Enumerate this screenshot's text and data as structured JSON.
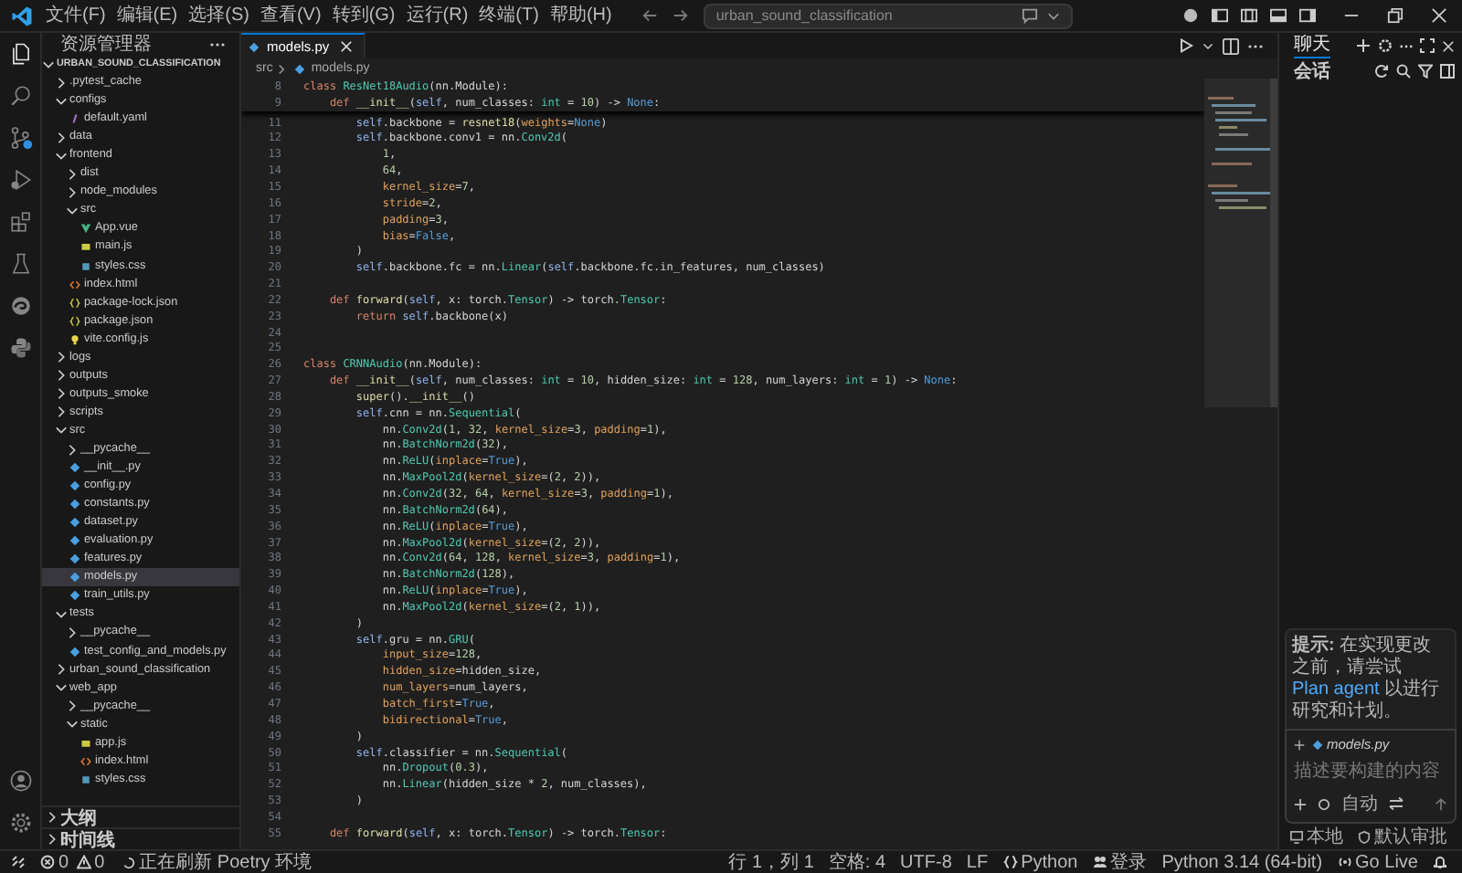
{
  "menu": [
    "文件(F)",
    "编辑(E)",
    "选择(S)",
    "查看(V)",
    "转到(G)",
    "运行(R)",
    "终端(T)",
    "帮助(H)"
  ],
  "command_center": {
    "value": "urban_sound_classification"
  },
  "explorer": {
    "title": "资源管理器",
    "root": {
      "name": "URBAN_SOUND_CLASSIFICATION",
      "expanded": true
    },
    "tree": [
      {
        "name": ".pytest_cache",
        "kind": "folder",
        "expanded": false,
        "selected": false
      },
      {
        "name": "configs",
        "kind": "folder",
        "expanded": true,
        "selected": false,
        "children": [
          {
            "name": "default.yaml",
            "kind": "yaml",
            "selected": false
          }
        ]
      },
      {
        "name": "data",
        "kind": "folder",
        "expanded": false,
        "selected": false
      },
      {
        "name": "frontend",
        "kind": "folder",
        "expanded": true,
        "selected": false,
        "children": [
          {
            "name": "dist",
            "kind": "folder",
            "expanded": false,
            "selected": false
          },
          {
            "name": "node_modules",
            "kind": "folder",
            "expanded": false,
            "selected": false
          },
          {
            "name": "src",
            "kind": "folder",
            "expanded": true,
            "selected": false,
            "children": [
              {
                "name": "App.vue",
                "kind": "vue",
                "selected": false
              },
              {
                "name": "main.js",
                "kind": "js",
                "selected": false
              },
              {
                "name": "styles.css",
                "kind": "css",
                "selected": false
              }
            ]
          },
          {
            "name": "index.html",
            "kind": "html",
            "selected": false
          },
          {
            "name": "package-lock.json",
            "kind": "json",
            "selected": false
          },
          {
            "name": "package.json",
            "kind": "json",
            "selected": false
          },
          {
            "name": "vite.config.js",
            "kind": "config",
            "selected": false
          }
        ]
      },
      {
        "name": "logs",
        "kind": "folder",
        "expanded": false,
        "selected": false
      },
      {
        "name": "outputs",
        "kind": "folder",
        "expanded": false,
        "selected": false
      },
      {
        "name": "outputs_smoke",
        "kind": "folder",
        "expanded": false,
        "selected": false
      },
      {
        "name": "scripts",
        "kind": "folder",
        "expanded": false,
        "selected": false
      },
      {
        "name": "src",
        "kind": "folder",
        "expanded": true,
        "selected": false,
        "children": [
          {
            "name": "__pycache__",
            "kind": "folder",
            "expanded": false,
            "selected": false
          },
          {
            "name": "__init__.py",
            "kind": "py",
            "selected": false
          },
          {
            "name": "config.py",
            "kind": "py",
            "selected": false
          },
          {
            "name": "constants.py",
            "kind": "py",
            "selected": false
          },
          {
            "name": "dataset.py",
            "kind": "py",
            "selected": false
          },
          {
            "name": "evaluation.py",
            "kind": "py",
            "selected": false
          },
          {
            "name": "features.py",
            "kind": "py",
            "selected": false
          },
          {
            "name": "models.py",
            "kind": "py",
            "selected": true
          },
          {
            "name": "train_utils.py",
            "kind": "py",
            "selected": false
          }
        ]
      },
      {
        "name": "tests",
        "kind": "folder",
        "expanded": true,
        "selected": false,
        "children": [
          {
            "name": "__pycache__",
            "kind": "folder",
            "expanded": false,
            "selected": false
          },
          {
            "name": "test_config_and_models.py",
            "kind": "py",
            "selected": false
          }
        ]
      },
      {
        "name": "urban_sound_classification",
        "kind": "folder",
        "expanded": false,
        "selected": false
      },
      {
        "name": "web_app",
        "kind": "folder",
        "expanded": true,
        "selected": false,
        "children": [
          {
            "name": "__pycache__",
            "kind": "folder",
            "expanded": false,
            "selected": false
          },
          {
            "name": "static",
            "kind": "folder",
            "expanded": true,
            "selected": false,
            "children": [
              {
                "name": "app.js",
                "kind": "js",
                "selected": false
              },
              {
                "name": "index.html",
                "kind": "html",
                "selected": false
              },
              {
                "name": "styles.css",
                "kind": "css",
                "selected": false
              }
            ]
          }
        ]
      }
    ],
    "sections": [
      {
        "name": "大纲",
        "expanded": false
      },
      {
        "name": "时间线",
        "expanded": false
      }
    ]
  },
  "editor": {
    "tab": {
      "name": "models.py",
      "selected": true
    },
    "breadcrumb": [
      "src",
      "models.py"
    ],
    "sticky_lines": [
      {
        "no": "8",
        "segs": [
          {
            "kind": "keyword",
            "text": "class "
          },
          {
            "kind": "type",
            "text": "ResNet18Audio"
          },
          {
            "kind": "plain",
            "text": "(nn.Module):"
          }
        ]
      },
      {
        "no": "9",
        "segs": [
          {
            "kind": "keyword",
            "text": "    def "
          },
          {
            "kind": "function",
            "text": "__init__"
          },
          {
            "kind": "plain",
            "text": "("
          },
          {
            "kind": "self",
            "text": "self"
          },
          {
            "kind": "plain",
            "text": ", num_classes: "
          },
          {
            "kind": "type",
            "text": "int"
          },
          {
            "kind": "plain",
            "text": " = "
          },
          {
            "kind": "number",
            "text": "10"
          },
          {
            "kind": "plain",
            "text": ") -> "
          },
          {
            "kind": "constant",
            "text": "None"
          },
          {
            "kind": "plain",
            "text": ":"
          }
        ]
      }
    ],
    "lines": [
      {
        "no": "11",
        "segs": [
          {
            "kind": "self",
            "text": "        self"
          },
          {
            "kind": "plain",
            "text": ".backbone = "
          },
          {
            "kind": "function",
            "text": "resnet18"
          },
          {
            "kind": "plain",
            "text": "("
          },
          {
            "kind": "param",
            "text": "weights"
          },
          {
            "kind": "plain",
            "text": "="
          },
          {
            "kind": "constant",
            "text": "None"
          },
          {
            "kind": "plain",
            "text": ")"
          }
        ]
      },
      {
        "no": "12",
        "segs": [
          {
            "kind": "self",
            "text": "        self"
          },
          {
            "kind": "plain",
            "text": ".backbone.conv1 = nn."
          },
          {
            "kind": "type",
            "text": "Conv2d"
          },
          {
            "kind": "plain",
            "text": "("
          }
        ]
      },
      {
        "no": "13",
        "segs": [
          {
            "kind": "number",
            "text": "            1"
          },
          {
            "kind": "plain",
            "text": ","
          }
        ]
      },
      {
        "no": "14",
        "segs": [
          {
            "kind": "number",
            "text": "            64"
          },
          {
            "kind": "plain",
            "text": ","
          }
        ]
      },
      {
        "no": "15",
        "segs": [
          {
            "kind": "param",
            "text": "            kernel_size"
          },
          {
            "kind": "plain",
            "text": "="
          },
          {
            "kind": "number",
            "text": "7"
          },
          {
            "kind": "plain",
            "text": ","
          }
        ]
      },
      {
        "no": "16",
        "segs": [
          {
            "kind": "param",
            "text": "            stride"
          },
          {
            "kind": "plain",
            "text": "="
          },
          {
            "kind": "number",
            "text": "2"
          },
          {
            "kind": "plain",
            "text": ","
          }
        ]
      },
      {
        "no": "17",
        "segs": [
          {
            "kind": "param",
            "text": "            padding"
          },
          {
            "kind": "plain",
            "text": "="
          },
          {
            "kind": "number",
            "text": "3"
          },
          {
            "kind": "plain",
            "text": ","
          }
        ]
      },
      {
        "no": "18",
        "segs": [
          {
            "kind": "param",
            "text": "            bias"
          },
          {
            "kind": "plain",
            "text": "="
          },
          {
            "kind": "constant",
            "text": "False"
          },
          {
            "kind": "plain",
            "text": ","
          }
        ]
      },
      {
        "no": "19",
        "segs": [
          {
            "kind": "plain",
            "text": "        )"
          }
        ]
      },
      {
        "no": "20",
        "segs": [
          {
            "kind": "self",
            "text": "        self"
          },
          {
            "kind": "plain",
            "text": ".backbone.fc = nn."
          },
          {
            "kind": "type",
            "text": "Linear"
          },
          {
            "kind": "plain",
            "text": "("
          },
          {
            "kind": "self",
            "text": "self"
          },
          {
            "kind": "plain",
            "text": ".backbone.fc.in_features, num_classes)"
          }
        ]
      },
      {
        "no": "21"
      },
      {
        "no": "22",
        "segs": [
          {
            "kind": "keyword",
            "text": "    def "
          },
          {
            "kind": "function",
            "text": "forward"
          },
          {
            "kind": "plain",
            "text": "("
          },
          {
            "kind": "self",
            "text": "self"
          },
          {
            "kind": "plain",
            "text": ", x: torch."
          },
          {
            "kind": "type",
            "text": "Tensor"
          },
          {
            "kind": "plain",
            "text": ") -> torch."
          },
          {
            "kind": "type",
            "text": "Tensor"
          },
          {
            "kind": "plain",
            "text": ":"
          }
        ]
      },
      {
        "no": "23",
        "segs": [
          {
            "kind": "keyword",
            "text": "        return "
          },
          {
            "kind": "self",
            "text": "self"
          },
          {
            "kind": "plain",
            "text": ".backbone(x)"
          }
        ]
      },
      {
        "no": "24"
      },
      {
        "no": "25"
      },
      {
        "no": "26",
        "segs": [
          {
            "kind": "keyword",
            "text": "class "
          },
          {
            "kind": "type",
            "text": "CRNNAudio"
          },
          {
            "kind": "plain",
            "text": "(nn.Module):"
          }
        ]
      },
      {
        "no": "27",
        "segs": [
          {
            "kind": "keyword",
            "text": "    def "
          },
          {
            "kind": "function",
            "text": "__init__"
          },
          {
            "kind": "plain",
            "text": "("
          },
          {
            "kind": "self",
            "text": "self"
          },
          {
            "kind": "plain",
            "text": ", num_classes: "
          },
          {
            "kind": "type",
            "text": "int"
          },
          {
            "kind": "plain",
            "text": " = "
          },
          {
            "kind": "number",
            "text": "10"
          },
          {
            "kind": "plain",
            "text": ", hidden_size: "
          },
          {
            "kind": "type",
            "text": "int"
          },
          {
            "kind": "plain",
            "text": " = "
          },
          {
            "kind": "number",
            "text": "128"
          },
          {
            "kind": "plain",
            "text": ", num_layers: "
          },
          {
            "kind": "type",
            "text": "int"
          },
          {
            "kind": "plain",
            "text": " = "
          },
          {
            "kind": "number",
            "text": "1"
          },
          {
            "kind": "plain",
            "text": ") -> "
          },
          {
            "kind": "constant",
            "text": "None"
          },
          {
            "kind": "plain",
            "text": ":"
          }
        ]
      },
      {
        "no": "28",
        "segs": [
          {
            "kind": "function",
            "text": "        super"
          },
          {
            "kind": "plain",
            "text": "()."
          },
          {
            "kind": "function",
            "text": "__init__"
          },
          {
            "kind": "plain",
            "text": "()"
          }
        ]
      },
      {
        "no": "29",
        "segs": [
          {
            "kind": "self",
            "text": "        self"
          },
          {
            "kind": "plain",
            "text": ".cnn = nn."
          },
          {
            "kind": "type",
            "text": "Sequential"
          },
          {
            "kind": "plain",
            "text": "("
          }
        ]
      },
      {
        "no": "30",
        "segs": [
          {
            "kind": "plain",
            "text": "            nn."
          },
          {
            "kind": "type",
            "text": "Conv2d"
          },
          {
            "kind": "plain",
            "text": "("
          },
          {
            "kind": "number",
            "text": "1"
          },
          {
            "kind": "plain",
            "text": ", "
          },
          {
            "kind": "number",
            "text": "32"
          },
          {
            "kind": "plain",
            "text": ", "
          },
          {
            "kind": "param",
            "text": "kernel_size"
          },
          {
            "kind": "plain",
            "text": "="
          },
          {
            "kind": "number",
            "text": "3"
          },
          {
            "kind": "plain",
            "text": ", "
          },
          {
            "kind": "param",
            "text": "padding"
          },
          {
            "kind": "plain",
            "text": "="
          },
          {
            "kind": "number",
            "text": "1"
          },
          {
            "kind": "plain",
            "text": "),"
          }
        ]
      },
      {
        "no": "31",
        "segs": [
          {
            "kind": "plain",
            "text": "            nn."
          },
          {
            "kind": "type",
            "text": "BatchNorm2d"
          },
          {
            "kind": "plain",
            "text": "("
          },
          {
            "kind": "number",
            "text": "32"
          },
          {
            "kind": "plain",
            "text": "),"
          }
        ]
      },
      {
        "no": "32",
        "segs": [
          {
            "kind": "plain",
            "text": "            nn."
          },
          {
            "kind": "type",
            "text": "ReLU"
          },
          {
            "kind": "plain",
            "text": "("
          },
          {
            "kind": "param",
            "text": "inplace"
          },
          {
            "kind": "plain",
            "text": "="
          },
          {
            "kind": "constant",
            "text": "True"
          },
          {
            "kind": "plain",
            "text": "),"
          }
        ]
      },
      {
        "no": "33",
        "segs": [
          {
            "kind": "plain",
            "text": "            nn."
          },
          {
            "kind": "type",
            "text": "MaxPool2d"
          },
          {
            "kind": "plain",
            "text": "("
          },
          {
            "kind": "param",
            "text": "kernel_size"
          },
          {
            "kind": "plain",
            "text": "=("
          },
          {
            "kind": "number",
            "text": "2"
          },
          {
            "kind": "plain",
            "text": ", "
          },
          {
            "kind": "number",
            "text": "2"
          },
          {
            "kind": "plain",
            "text": ")),"
          }
        ]
      },
      {
        "no": "34",
        "segs": [
          {
            "kind": "plain",
            "text": "            nn."
          },
          {
            "kind": "type",
            "text": "Conv2d"
          },
          {
            "kind": "plain",
            "text": "("
          },
          {
            "kind": "number",
            "text": "32"
          },
          {
            "kind": "plain",
            "text": ", "
          },
          {
            "kind": "number",
            "text": "64"
          },
          {
            "kind": "plain",
            "text": ", "
          },
          {
            "kind": "param",
            "text": "kernel_size"
          },
          {
            "kind": "plain",
            "text": "="
          },
          {
            "kind": "number",
            "text": "3"
          },
          {
            "kind": "plain",
            "text": ", "
          },
          {
            "kind": "param",
            "text": "padding"
          },
          {
            "kind": "plain",
            "text": "="
          },
          {
            "kind": "number",
            "text": "1"
          },
          {
            "kind": "plain",
            "text": "),"
          }
        ]
      },
      {
        "no": "35",
        "segs": [
          {
            "kind": "plain",
            "text": "            nn."
          },
          {
            "kind": "type",
            "text": "BatchNorm2d"
          },
          {
            "kind": "plain",
            "text": "("
          },
          {
            "kind": "number",
            "text": "64"
          },
          {
            "kind": "plain",
            "text": "),"
          }
        ]
      },
      {
        "no": "36",
        "segs": [
          {
            "kind": "plain",
            "text": "            nn."
          },
          {
            "kind": "type",
            "text": "ReLU"
          },
          {
            "kind": "plain",
            "text": "("
          },
          {
            "kind": "param",
            "text": "inplace"
          },
          {
            "kind": "plain",
            "text": "="
          },
          {
            "kind": "constant",
            "text": "True"
          },
          {
            "kind": "plain",
            "text": "),"
          }
        ]
      },
      {
        "no": "37",
        "segs": [
          {
            "kind": "plain",
            "text": "            nn."
          },
          {
            "kind": "type",
            "text": "MaxPool2d"
          },
          {
            "kind": "plain",
            "text": "("
          },
          {
            "kind": "param",
            "text": "kernel_size"
          },
          {
            "kind": "plain",
            "text": "=("
          },
          {
            "kind": "number",
            "text": "2"
          },
          {
            "kind": "plain",
            "text": ", "
          },
          {
            "kind": "number",
            "text": "2"
          },
          {
            "kind": "plain",
            "text": ")),"
          }
        ]
      },
      {
        "no": "38",
        "segs": [
          {
            "kind": "plain",
            "text": "            nn."
          },
          {
            "kind": "type",
            "text": "Conv2d"
          },
          {
            "kind": "plain",
            "text": "("
          },
          {
            "kind": "number",
            "text": "64"
          },
          {
            "kind": "plain",
            "text": ", "
          },
          {
            "kind": "number",
            "text": "128"
          },
          {
            "kind": "plain",
            "text": ", "
          },
          {
            "kind": "param",
            "text": "kernel_size"
          },
          {
            "kind": "plain",
            "text": "="
          },
          {
            "kind": "number",
            "text": "3"
          },
          {
            "kind": "plain",
            "text": ", "
          },
          {
            "kind": "param",
            "text": "padding"
          },
          {
            "kind": "plain",
            "text": "="
          },
          {
            "kind": "number",
            "text": "1"
          },
          {
            "kind": "plain",
            "text": "),"
          }
        ]
      },
      {
        "no": "39",
        "segs": [
          {
            "kind": "plain",
            "text": "            nn."
          },
          {
            "kind": "type",
            "text": "BatchNorm2d"
          },
          {
            "kind": "plain",
            "text": "("
          },
          {
            "kind": "number",
            "text": "128"
          },
          {
            "kind": "plain",
            "text": "),"
          }
        ]
      },
      {
        "no": "40",
        "segs": [
          {
            "kind": "plain",
            "text": "            nn."
          },
          {
            "kind": "type",
            "text": "ReLU"
          },
          {
            "kind": "plain",
            "text": "("
          },
          {
            "kind": "param",
            "text": "inplace"
          },
          {
            "kind": "plain",
            "text": "="
          },
          {
            "kind": "constant",
            "text": "True"
          },
          {
            "kind": "plain",
            "text": "),"
          }
        ]
      },
      {
        "no": "41",
        "segs": [
          {
            "kind": "plain",
            "text": "            nn."
          },
          {
            "kind": "type",
            "text": "MaxPool2d"
          },
          {
            "kind": "plain",
            "text": "("
          },
          {
            "kind": "param",
            "text": "kernel_size"
          },
          {
            "kind": "plain",
            "text": "=("
          },
          {
            "kind": "number",
            "text": "2"
          },
          {
            "kind": "plain",
            "text": ", "
          },
          {
            "kind": "number",
            "text": "1"
          },
          {
            "kind": "plain",
            "text": ")),"
          }
        ]
      },
      {
        "no": "42",
        "segs": [
          {
            "kind": "plain",
            "text": "        )"
          }
        ]
      },
      {
        "no": "43",
        "segs": [
          {
            "kind": "self",
            "text": "        self"
          },
          {
            "kind": "plain",
            "text": ".gru = nn."
          },
          {
            "kind": "type",
            "text": "GRU"
          },
          {
            "kind": "plain",
            "text": "("
          }
        ]
      },
      {
        "no": "44",
        "segs": [
          {
            "kind": "param",
            "text": "            input_size"
          },
          {
            "kind": "plain",
            "text": "="
          },
          {
            "kind": "number",
            "text": "128"
          },
          {
            "kind": "plain",
            "text": ","
          }
        ]
      },
      {
        "no": "45",
        "segs": [
          {
            "kind": "param",
            "text": "            hidden_size"
          },
          {
            "kind": "plain",
            "text": "=hidden_size,"
          }
        ]
      },
      {
        "no": "46",
        "segs": [
          {
            "kind": "param",
            "text": "            num_layers"
          },
          {
            "kind": "plain",
            "text": "=num_layers,"
          }
        ]
      },
      {
        "no": "47",
        "segs": [
          {
            "kind": "param",
            "text": "            batch_first"
          },
          {
            "kind": "plain",
            "text": "="
          },
          {
            "kind": "constant",
            "text": "True"
          },
          {
            "kind": "plain",
            "text": ","
          }
        ]
      },
      {
        "no": "48",
        "segs": [
          {
            "kind": "param",
            "text": "            bidirectional"
          },
          {
            "kind": "plain",
            "text": "="
          },
          {
            "kind": "constant",
            "text": "True"
          },
          {
            "kind": "plain",
            "text": ","
          }
        ]
      },
      {
        "no": "49",
        "segs": [
          {
            "kind": "plain",
            "text": "        )"
          }
        ]
      },
      {
        "no": "50",
        "segs": [
          {
            "kind": "self",
            "text": "        self"
          },
          {
            "kind": "plain",
            "text": ".classifier = nn."
          },
          {
            "kind": "type",
            "text": "Sequential"
          },
          {
            "kind": "plain",
            "text": "("
          }
        ]
      },
      {
        "no": "51",
        "segs": [
          {
            "kind": "plain",
            "text": "            nn."
          },
          {
            "kind": "type",
            "text": "Dropout"
          },
          {
            "kind": "plain",
            "text": "("
          },
          {
            "kind": "number",
            "text": "0.3"
          },
          {
            "kind": "plain",
            "text": "),"
          }
        ]
      },
      {
        "no": "52",
        "segs": [
          {
            "kind": "plain",
            "text": "            nn."
          },
          {
            "kind": "type",
            "text": "Linear"
          },
          {
            "kind": "plain",
            "text": "(hidden_size * "
          },
          {
            "kind": "number",
            "text": "2"
          },
          {
            "kind": "plain",
            "text": ", num_classes),"
          }
        ]
      },
      {
        "no": "53",
        "segs": [
          {
            "kind": "plain",
            "text": "        )"
          }
        ]
      },
      {
        "no": "54"
      },
      {
        "no": "55",
        "segs": [
          {
            "kind": "keyword",
            "text": "    def "
          },
          {
            "kind": "function",
            "text": "forward"
          },
          {
            "kind": "plain",
            "text": "("
          },
          {
            "kind": "self",
            "text": "self"
          },
          {
            "kind": "plain",
            "text": ", x: torch."
          },
          {
            "kind": "type",
            "text": "Tensor"
          },
          {
            "kind": "plain",
            "text": ") -> torch."
          },
          {
            "kind": "type",
            "text": "Tensor"
          },
          {
            "kind": "plain",
            "text": ":"
          }
        ]
      }
    ]
  },
  "chat": {
    "tab": {
      "label": "聊天",
      "selected": true
    },
    "sessions_label": "会话",
    "tip": {
      "before": "**提示:** 在实现更改之前，请尝试 ",
      "link": "Plan agent",
      "after": " 以进行研究和计划。"
    },
    "context_file": "models.py",
    "placeholder": "描述要构建的内容",
    "mode": "自动",
    "footer": [
      "本地",
      "默认审批"
    ]
  },
  "status_bar": {
    "errors": "0",
    "warnings": "0",
    "task": "正在刷新 Poetry 环境",
    "right": [
      {
        "text": "行 1，列 1",
        "kind": "text"
      },
      {
        "text": "空格: 4",
        "kind": "text"
      },
      {
        "text": "UTF-8",
        "kind": "text"
      },
      {
        "text": "LF",
        "kind": "text"
      },
      {
        "text": "Python",
        "kind": "language"
      },
      {
        "text": "登录",
        "kind": "account"
      },
      {
        "text": "Python 3.14 (64-bit)",
        "kind": "text"
      },
      {
        "text": "Go Live",
        "kind": "live"
      }
    ]
  }
}
